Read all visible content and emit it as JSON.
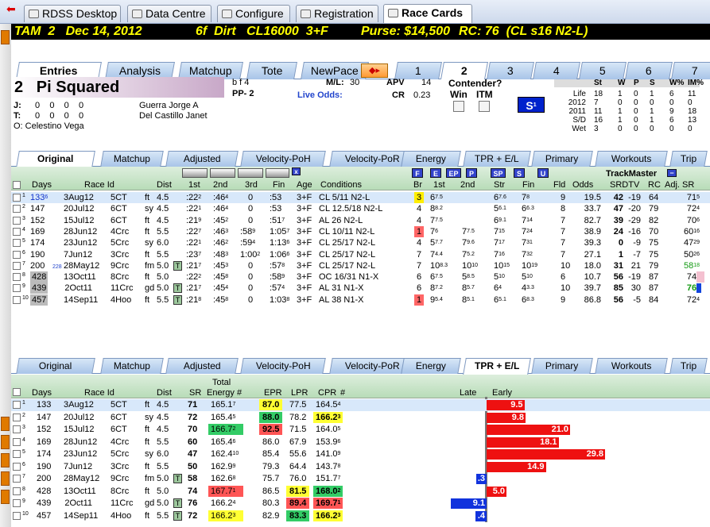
{
  "nav_tabs": [
    {
      "label": "RDSS Desktop",
      "icon": "home-icon"
    },
    {
      "label": "Data Centre",
      "icon": "database-icon"
    },
    {
      "label": "Configure",
      "icon": "gear-icon"
    },
    {
      "label": "Registration",
      "icon": "key-icon"
    },
    {
      "label": "Race Cards",
      "icon": "book-icon"
    }
  ],
  "race_header": {
    "track": "TAM  2   Dec 14, 2012",
    "distance": "6f  Dirt   CL16000  3+F",
    "purse": "Purse: $14,500",
    "rc": "RC: 76  (CL s16 N2-L)"
  },
  "entry_tabs": [
    "Entries",
    "Analysis",
    "Matchup",
    "Tote",
    "NewPace"
  ],
  "post_tabs": [
    "1",
    "2",
    "3",
    "4",
    "5",
    "6",
    "7"
  ],
  "horse": {
    "number": "2",
    "name": "Pi Squared",
    "sex_age": "b f 4",
    "pp": "PP- 2",
    "ml_label": "M/L:",
    "ml": "30",
    "apv_label": "APV",
    "apv": "14",
    "live_odds_label": "Live Odds:",
    "cr_label": "CR",
    "cr": "0.23",
    "contender_label": "Contender?",
    "win_label": "Win",
    "itm_label": "ITM",
    "s_badge": "S",
    "s_badge_sup": "1",
    "j_label": "J:",
    "j_stats": "0    0    0    0",
    "t_label": "T:",
    "t_stats": "0    0    0    0",
    "jockey": "Guerra Jorge A",
    "trainer": "Del Castillo Janet",
    "owner": "O:  Celestino Vega"
  },
  "record": {
    "headers": [
      "St",
      "W",
      "P",
      "S",
      "W%",
      "IM%"
    ],
    "rows": [
      {
        "label": "Life",
        "vals": [
          "18",
          "1",
          "0",
          "1",
          "6",
          "11"
        ]
      },
      {
        "label": "2012",
        "vals": [
          "7",
          "0",
          "0",
          "0",
          "0",
          "0"
        ]
      },
      {
        "label": "2011",
        "vals": [
          "11",
          "1",
          "0",
          "1",
          "9",
          "18"
        ]
      },
      {
        "label": "S/D",
        "vals": [
          "16",
          "1",
          "0",
          "1",
          "6",
          "13"
        ]
      },
      {
        "label": "Wet",
        "vals": [
          "3",
          "0",
          "0",
          "0",
          "0",
          "0"
        ]
      }
    ]
  },
  "sub_tabs": [
    "Original",
    "Matchup",
    "Adjusted",
    "Velocity-PoH",
    "Velocity-PoR",
    "Energy",
    "TPR + E/L",
    "Primary",
    "Workouts",
    "Trip"
  ],
  "pp_headers": {
    "days": "Days",
    "raceid": "Race Id",
    "dist": "Dist",
    "c1": "1st",
    "c2": "2nd",
    "c3": "3rd",
    "fin": "Fin",
    "age": "Age",
    "cond": "Conditions",
    "br": "Br",
    "b1": "1st",
    "b2": "2nd",
    "str": "Str",
    "bfin": "Fin",
    "fld": "Fld",
    "odds": "Odds",
    "trackmaster": "TrackMaster",
    "srdtv": "SRDTV",
    "rc": "RC",
    "adjsr": "Adj. SR",
    "x": "x"
  },
  "pace_buttons": [
    "F",
    "E",
    "EP",
    "P",
    "SP",
    "S",
    "U"
  ],
  "pp_rows": [
    {
      "n": "1",
      "days": "133",
      "dsup": "6",
      "date": "3Aug12",
      "trk": "5CT",
      "sfc": "ft",
      "dist": "4.5",
      "f1": ":22",
      "f1s": "2",
      "f2": ":46",
      "f2s": "4",
      "f3": "0",
      "fin": ":53",
      "fins": "",
      "age": "3+F",
      "cond": "CL 5/11 N2-L",
      "br": "3",
      "b1": "6",
      "b1s": "7.5",
      "b2": "",
      "b2s": "",
      "str": "6",
      "strs": "7.6",
      "bf": "7",
      "bfs": "8",
      "fld": "9",
      "odds": "19.5",
      "sr": "42",
      "dtv": "-19",
      "rc": "64",
      "adj": "71",
      "adjs": "5"
    },
    {
      "n": "2",
      "days": "147",
      "dsup": "",
      "date": "20Jul12",
      "trk": "6CT",
      "sfc": "sy",
      "dist": "4.5",
      "f1": ":22",
      "f1s": "1",
      "f2": ":46",
      "f2s": "4",
      "f3": "0",
      "fin": ":53",
      "fins": "",
      "age": "3+F",
      "cond": "CL 12.5/18 N2-L",
      "br": "4",
      "b1": "8",
      "b1s": "8.2",
      "b2": "",
      "b2s": "",
      "str": "5",
      "strs": "6.1",
      "bf": "6",
      "bfs": "6.3",
      "fld": "8",
      "odds": "33.7",
      "sr": "47",
      "dtv": "-20",
      "rc": "79",
      "adj": "72",
      "adjs": "4"
    },
    {
      "n": "3",
      "days": "152",
      "dsup": "",
      "date": "15Jul12",
      "trk": "6CT",
      "sfc": "ft",
      "dist": "4.5",
      "f1": ":21",
      "f1s": "9",
      "f2": ":45",
      "f2s": "2",
      "f3": "0",
      "fin": ":51",
      "fins": "7",
      "age": "3+F",
      "cond": "AL 26 N2-L",
      "br": "4",
      "b1": "7",
      "b1s": "7.5",
      "b2": "",
      "b2s": "",
      "str": "6",
      "strs": "9.1",
      "bf": "7",
      "bfs": "14",
      "fld": "7",
      "odds": "82.7",
      "sr": "39",
      "dtv": "-29",
      "rc": "82",
      "adj": "70",
      "adjs": "6"
    },
    {
      "n": "4",
      "days": "169",
      "dsup": "",
      "date": "28Jun12",
      "trk": "4Crc",
      "sfc": "ft",
      "dist": "5.5",
      "f1": ":22",
      "f1s": "7",
      "f2": ":46",
      "f2s": "3",
      "f3": ":58",
      "f3s": "9",
      "fin": "1:05",
      "fins": "7",
      "age": "3+F",
      "cond": "CL 10/11 N2-L",
      "br": "1",
      "b1": "7",
      "b1s": "6",
      "b2": "7",
      "b2s": "7.5",
      "str": "7",
      "strs": "15",
      "bf": "7",
      "bfs": "24",
      "fld": "7",
      "odds": "38.9",
      "sr": "24",
      "dtv": "-16",
      "rc": "70",
      "adj": "60",
      "adjs": "16"
    },
    {
      "n": "5",
      "days": "174",
      "dsup": "",
      "date": "23Jun12",
      "trk": "5Crc",
      "sfc": "sy",
      "dist": "6.0",
      "f1": ":22",
      "f1s": "1",
      "f2": ":46",
      "f2s": "2",
      "f3": ":59",
      "f3s": "4",
      "fin": "1:13",
      "fins": "6",
      "age": "3+F",
      "cond": "CL 25/17 N2-L",
      "br": "4",
      "b1": "5",
      "b1s": "7.7",
      "b2": "7",
      "b2s": "9.6",
      "str": "7",
      "strs": "17",
      "bf": "7",
      "bfs": "31",
      "fld": "7",
      "odds": "39.3",
      "sr": "0",
      "dtv": "-9",
      "rc": "75",
      "adj": "47",
      "adjs": "29"
    },
    {
      "n": "6",
      "days": "190",
      "dsup": "",
      "date": "7Jun12",
      "trk": "3Crc",
      "sfc": "ft",
      "dist": "5.5",
      "f1": ":23",
      "f1s": "7",
      "f2": ":48",
      "f2s": "3",
      "f3": "1:00",
      "f3s": "2",
      "fin": "1:06",
      "fins": "6",
      "age": "3+F",
      "cond": "CL 25/17 N2-L",
      "br": "7",
      "b1": "7",
      "b1s": "4.4",
      "b2": "7",
      "b2s": "5.2",
      "str": "7",
      "strs": "16",
      "bf": "7",
      "bfs": "32",
      "fld": "7",
      "odds": "27.1",
      "sr": "1",
      "dtv": "-7",
      "rc": "75",
      "adj": "50",
      "adjs": "26"
    },
    {
      "n": "7",
      "days": "200",
      "dsup": "",
      "dsmall": "228",
      "date": "28May12",
      "trk": "9Crc",
      "sfc": "fm",
      "dist": "5.0",
      "surf": "T",
      "f1": ":21",
      "f1s": "7",
      "f2": ":45",
      "f2s": "3",
      "f3": "0",
      "fin": ":57",
      "fins": "8",
      "age": "3+F",
      "cond": "CL 25/17 N2-L",
      "br": "7",
      "b1": "10",
      "b1s": "8.3",
      "b2": "10",
      "b2s": "10",
      "str": "10",
      "strs": "15",
      "bf": "10",
      "bfs": "19",
      "fld": "10",
      "odds": "18.0",
      "sr": "31",
      "dtv": "21",
      "rc": "79",
      "adj": "58",
      "adjs": "18"
    },
    {
      "n": "8",
      "days": "428",
      "dsup": "",
      "date": "13Oct11",
      "trk": "8Crc",
      "sfc": "ft",
      "dist": "5.0",
      "f1": ":22",
      "f1s": "2",
      "f2": ":45",
      "f2s": "8",
      "f3": "0",
      "fin": ":58",
      "fins": "9",
      "age": "3+F",
      "cond": "OC 16/31 N1-X",
      "br": "6",
      "b1": "6",
      "b1s": "7.5",
      "b2": "5",
      "b2s": "8.5",
      "str": "5",
      "strs": "10",
      "bf": "5",
      "bfs": "10",
      "fld": "6",
      "odds": "10.7",
      "sr": "56",
      "dtv": "-19",
      "rc": "87",
      "adj": "74",
      "adjs": "2"
    },
    {
      "n": "9",
      "days": "439",
      "dsup": "",
      "date": "2Oct11",
      "trk": "11Crc",
      "sfc": "gd",
      "dist": "5.0",
      "surf": "T",
      "f1": ":21",
      "f1s": "7",
      "f2": ":45",
      "f2s": "4",
      "f3": "0",
      "fin": ":57",
      "fins": "4",
      "age": "3+F",
      "cond": "AL 31 N1-X",
      "br": "6",
      "b1": "8",
      "b1s": "7.2",
      "b2": "8",
      "b2s": "5.7",
      "str": "6",
      "strs": "4",
      "bf": "4",
      "bfs": "3.3",
      "fld": "10",
      "odds": "39.7",
      "sr": "85",
      "dtv": "30",
      "rc": "87",
      "adj": "76",
      "adjs": "9"
    },
    {
      "n": "10",
      "days": "457",
      "dsup": "",
      "date": "14Sep11",
      "trk": "4Hoo",
      "sfc": "ft",
      "dist": "5.5",
      "surf": "T",
      "f1": ":21",
      "f1s": "8",
      "f2": ":45",
      "f2s": "8",
      "f3": "0",
      "fin": "1:03",
      "fins": "8",
      "age": "3+F",
      "cond": "AL 38 N1-X",
      "br": "1",
      "b1": "9",
      "b1s": "5.4",
      "b2": "8",
      "b2s": "5.1",
      "str": "6",
      "strs": "5.1",
      "bf": "6",
      "bfs": "8.3",
      "fld": "9",
      "odds": "86.8",
      "sr": "56",
      "dtv": "-5",
      "rc": "84",
      "adj": "72",
      "adjs": "4"
    }
  ],
  "tpr_headers": {
    "days": "Days",
    "raceid": "Race Id",
    "dist": "Dist",
    "sr": "SR",
    "total": "Total",
    "energy": "Energy",
    "hash": "#",
    "epr": "EPR",
    "lpr": "LPR",
    "cpr": "CPR",
    "hash2": "#",
    "late": "Late",
    "early": "Early"
  },
  "tpr_rows": [
    {
      "n": "1",
      "days": "133",
      "date": "3Aug12",
      "trk": "5CT",
      "sfc": "ft",
      "dist": "4.5",
      "sr": "71",
      "energy": "165.1",
      "es": "7",
      "epr": "87.0",
      "lpr": "77.5",
      "cpr": "164.5",
      "cs": "4",
      "bar": "9.5",
      "bv": 9.5
    },
    {
      "n": "2",
      "days": "147",
      "date": "20Jul12",
      "trk": "6CT",
      "sfc": "sy",
      "dist": "4.5",
      "sr": "72",
      "energy": "165.4",
      "es": "5",
      "epr": "88.0",
      "lpr": "78.2",
      "cpr": "166.2",
      "cs": "3",
      "bar": "9.8",
      "bv": 9.8
    },
    {
      "n": "3",
      "days": "152",
      "date": "15Jul12",
      "trk": "6CT",
      "sfc": "ft",
      "dist": "4.5",
      "sr": "70",
      "energy": "166.7",
      "es": "2",
      "epr": "92.5",
      "lpr": "71.5",
      "cpr": "164.0",
      "cs": "5",
      "bar": "21.0",
      "bv": 21.0
    },
    {
      "n": "4",
      "days": "169",
      "date": "28Jun12",
      "trk": "4Crc",
      "sfc": "ft",
      "dist": "5.5",
      "sr": "60",
      "energy": "165.4",
      "es": "6",
      "epr": "86.0",
      "lpr": "67.9",
      "cpr": "153.9",
      "cs": "6",
      "bar": "18.1",
      "bv": 18.1
    },
    {
      "n": "5",
      "days": "174",
      "date": "23Jun12",
      "trk": "5Crc",
      "sfc": "sy",
      "dist": "6.0",
      "sr": "47",
      "energy": "162.4",
      "es": "10",
      "epr": "85.4",
      "lpr": "55.6",
      "cpr": "141.0",
      "cs": "9",
      "bar": "29.8",
      "bv": 29.8
    },
    {
      "n": "6",
      "days": "190",
      "date": "7Jun12",
      "trk": "3Crc",
      "sfc": "ft",
      "dist": "5.5",
      "sr": "50",
      "energy": "162.9",
      "es": "9",
      "epr": "79.3",
      "lpr": "64.4",
      "cpr": "143.7",
      "cs": "8",
      "bar": "14.9",
      "bv": 14.9
    },
    {
      "n": "7",
      "days": "200",
      "date": "28May12",
      "trk": "9Crc",
      "sfc": "fm",
      "dist": "5.0",
      "surf": "T",
      "sr": "58",
      "energy": "162.6",
      "es": "8",
      "epr": "75.7",
      "lpr": "76.0",
      "cpr": "151.7",
      "cs": "7",
      "bar": ".3",
      "bv": -0.3
    },
    {
      "n": "8",
      "days": "428",
      "date": "13Oct11",
      "trk": "8Crc",
      "sfc": "ft",
      "dist": "5.0",
      "sr": "74",
      "energy": "167.7",
      "es": "1",
      "epr": "86.5",
      "lpr": "81.5",
      "cpr": "168.0",
      "cs": "2",
      "bar": "5.0",
      "bv": 5.0
    },
    {
      "n": "9",
      "days": "439",
      "date": "2Oct11",
      "trk": "11Crc",
      "sfc": "gd",
      "dist": "5.0",
      "surf": "T",
      "sr": "76",
      "energy": "166.2",
      "es": "4",
      "epr": "80.3",
      "lpr": "89.4",
      "cpr": "169.7",
      "cs": "1",
      "bar": "9.1",
      "bv": -9.1
    },
    {
      "n": "10",
      "days": "457",
      "date": "14Sep11",
      "trk": "4Hoo",
      "sfc": "ft",
      "dist": "5.5",
      "surf": "T",
      "sr": "72",
      "energy": "166.2",
      "es": "3",
      "epr": "82.9",
      "lpr": "83.3",
      "cpr": "166.2",
      "cs": "3",
      "bar": ".4",
      "bv": -0.4
    }
  ],
  "colors": {
    "yellow": "#ffff33",
    "green": "#33cc66",
    "red": "#ff5555",
    "blue": "#1133dd",
    "barred": "#ee1111"
  }
}
